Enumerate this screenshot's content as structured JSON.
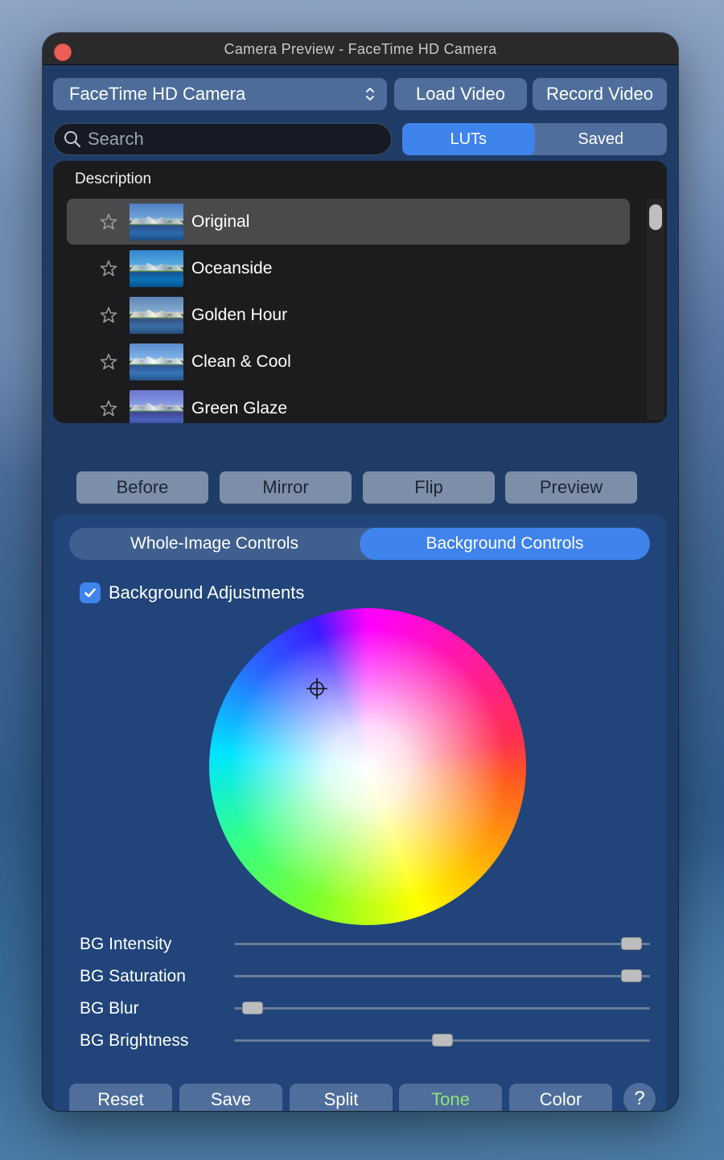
{
  "window": {
    "title": "Camera  Preview - FaceTime HD Camera"
  },
  "toolbar": {
    "camera_select": "FaceTime HD Camera",
    "load_video": "Load Video",
    "record_video": "Record Video"
  },
  "search": {
    "placeholder": "Search"
  },
  "lut_tabs": {
    "luts": "LUTs",
    "saved": "Saved",
    "active": "LUTs"
  },
  "lut_list": {
    "header": "Description",
    "selected": "Original",
    "items": [
      {
        "label": "Original"
      },
      {
        "label": "Oceanside"
      },
      {
        "label": "Golden Hour"
      },
      {
        "label": "Clean & Cool"
      },
      {
        "label": "Green Glaze"
      }
    ]
  },
  "actions": {
    "before": "Before",
    "mirror": "Mirror",
    "flip": "Flip",
    "preview": "Preview"
  },
  "control_tabs": {
    "whole_image": "Whole-Image Controls",
    "background": "Background Controls",
    "active": "Background Controls"
  },
  "background_adjustments": {
    "label": "Background Adjustments",
    "checked": true
  },
  "sliders": [
    {
      "label": "BG Intensity",
      "value": 0.98
    },
    {
      "label": "BG Saturation",
      "value": 0.98
    },
    {
      "label": "BG Blur",
      "value": 0.02
    },
    {
      "label": "BG Brightness",
      "value": 0.5
    }
  ],
  "bottom_buttons": {
    "reset": "Reset",
    "save": "Save",
    "split": "Split",
    "tone": "Tone",
    "color": "Color",
    "help": "?"
  },
  "colors": {
    "accent": "#3f83ec",
    "tone_text": "#8fe37a",
    "close": "#ec5f56"
  },
  "icons": [
    "close-icon",
    "chevron-updown-icon",
    "search-icon",
    "star-icon",
    "checkmark-icon",
    "crosshair-icon"
  ]
}
